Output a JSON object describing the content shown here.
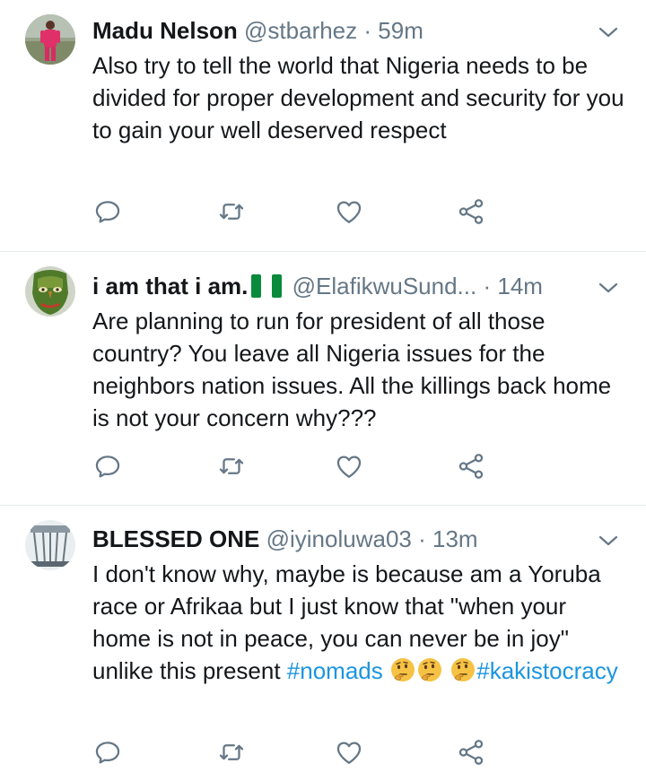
{
  "tweets": [
    {
      "name": "Madu Nelson",
      "handle": "@stbarhez",
      "separator": "·",
      "time": "59m",
      "text": "Also try to tell the world that Nigeria needs to be divided for proper development and security for you to gain your well deserved respect",
      "avatar": "person-in-red-outfit"
    },
    {
      "name": "i am that i am.",
      "name_emoji": "nigeria-flag",
      "handle": "@ElafikwuSund...",
      "separator": "·",
      "time": "14m",
      "text": "Are planning to run for president of all those country? You leave all Nigeria issues for the neighbors nation issues. All the killings back home is not your concern why???",
      "avatar": "green-mask"
    },
    {
      "name": "BLESSED ONE",
      "handle": "@iyinoluwa03",
      "separator": "·",
      "time": "13m",
      "text_before": "I don't know why, maybe is because am a Yoruba race or Afrikaa but I just know that \"when your home is not in peace, you can never be in joy\" unlike this present ",
      "hashtag1": "#nomads",
      "hashtag2": "#kakistocracy",
      "emoji": "thinking-face",
      "avatar": "building-columns"
    }
  ],
  "icons": {
    "reply": "reply-icon",
    "retweet": "retweet-icon",
    "like": "like-icon",
    "share": "share-icon",
    "caret": "chevron-down-icon"
  },
  "colors": {
    "text": "#14171a",
    "secondary": "#657786",
    "link": "#1b95e0",
    "divider": "#e6ecf0"
  }
}
